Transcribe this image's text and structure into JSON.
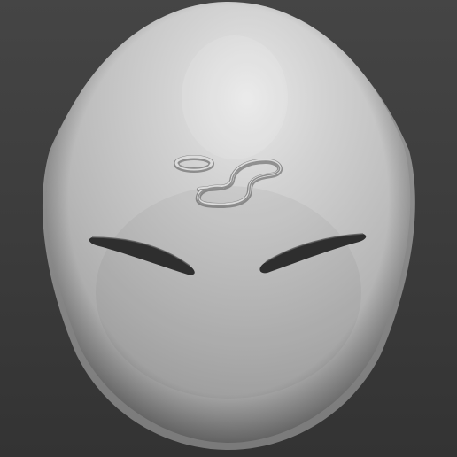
{
  "scene": {
    "background_color": "#3c3c3c",
    "object": "mask-3d-render",
    "mask_color": "#c4c4c4",
    "highlight_color": "#e6e6e6",
    "shadow_color": "#6a6a6a",
    "slit_color": "#2f2f2f",
    "emblem": "forehead-engraved-symbol"
  }
}
